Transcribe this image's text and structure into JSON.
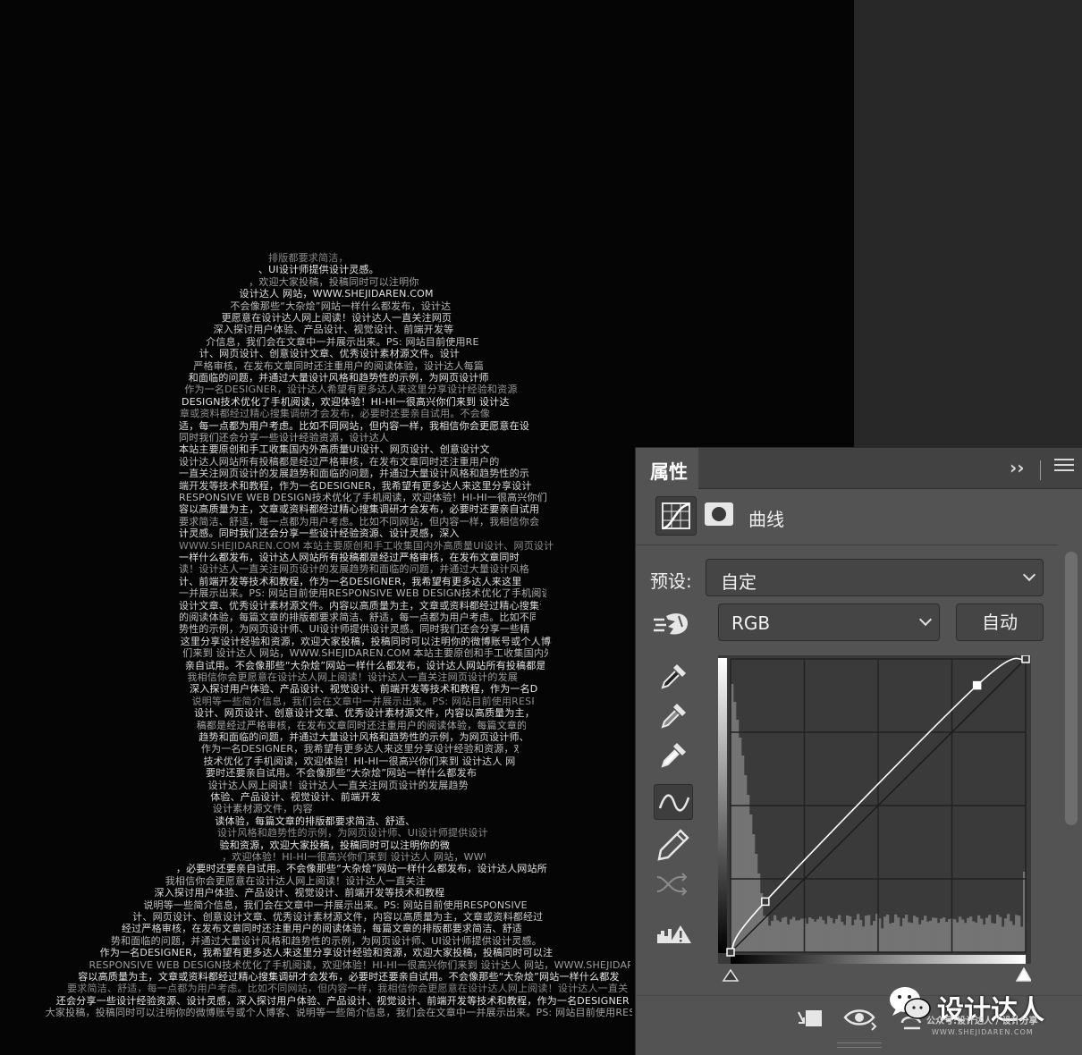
{
  "canvas": {
    "text_lines": [
      "排版都要求简洁，",
      "、UI设计师提供设计灵感。",
      "，欢迎大家投稿，投稿同时可以注明你",
      "设计达人 网站，WWW.SHEJIDAREN.COM",
      "不会像那些“大杂烩”网站一样什么都发布，设计达",
      "更愿意在设计达人网上阅读！设计达人一直关注网页",
      "深入探讨用户体验、产品设计、视觉设计、前端开发等",
      "介信息，我们会在文章中一并展示出来。PS: 网站目前使用RE",
      "计、网页设计、创意设计文章、优秀设计素材源文件。设计",
      "严格审核，在发布文章同时还注重用户的阅读体验，设计达人每篇",
      "和面临的问题，并通过大量设计风格和趋势性的示例，为网页设计师",
      "作为一名DESIGNER，设计达人希望有更多达人来这里分享设计经验和资源",
      "DESIGN技术优化了手机阅读，欢迎体验！HI-HI一很高兴你们来到 设计达",
      "章或资料都经过精心搜集调研才会发布，必要时还要亲自试用。不会像",
      "适，每一点都为用户考虑。比如不同网站，但内容一样，我相信你会更愿意在设",
      "同时我们还会分享一些设计经验资源，设计达人",
      "本站主要原创和手工收集国内外高质量UI设计、网页设计、创意设计文",
      "设计达人网站所有投稿都是经过严格审核，在发布文章同时还注重用户的",
      "一直关注网页设计的发展趋势和面临的问题，并通过大量设计风格和趋势性的示",
      "端开发等技术和教程，作为一名DESIGNER，我希望有更多达人来这里分享设计",
      "RESPONSIVE WEB DESIGN技术优化了手机阅读，欢迎体验！HI-HI一很高兴你们",
      "容以高质量为主，文章或资料都经过精心搜集调研才会发布，必要时还要亲自试用",
      "要求简洁、舒适，每一点都为用户考虑。比如不同网站，但内容一样，我相信你会",
      "计灵感。同时我们还会分享一些设计经验资源、设计灵感，深入",
      "WWW.SHEJIDAREN.COM 本站主要原创和手工收集国内外高质量UI设计、网页设计",
      "一样什么都发布，设计达人网站所有投稿都是经过严格审核，在发布文章同时",
      "读！设计达人一直关注网页设计的发展趋势和面临的问题，并通过大量设计风格",
      "计、前端开发等技术和教程，作为一名DESIGNER，我希望有更多达人来这里",
      "一并展示出来。PS: 网站目前使用RESPONSIVE WEB DESIGN技术优化了手机阅读，欢迎体验！",
      "设计文章、优秀设计素材源文件。内容以高质量为主，文章或资料都经过精心搜集调研才会发布，",
      "的阅读体验，每篇文章的排版都要求简洁、舒适，每一点都为用户考虑。比如不同网站，",
      "势性的示例，为网页设计师、UI设计师提供设计灵感。同时我们还会分享一些精品",
      "这里分享设计经验和资源，欢迎大家投稿，投稿同时可以注明你的微博账号或个人博客、说明等一些",
      "们来到 设计达人 网站，WWW.SHEJIDAREN.COM 本站主要原创和手工收集国内外",
      "亲自试用。不会像那些“大杂烩”网站一样什么都发布，设计达人网站所有投稿都是经过",
      "我相信你会更愿意在设计达人网上阅读！设计达人一直关注网页设计的发展",
      "深入探讨用户体验、产品设计、视觉设计、前端开发等技术和教程，作为一名DES",
      "说明等一些简介信息，我们会在文章中一并展示出来。PS: 网站目前使用RESPONSIVE WEB DESIGN技术",
      "设计、网页设计、创意设计文章、优秀设计素材源文件，内容以高质量为主，文章或资",
      "稿都是经过严格审核，在发布文章同时还注重用户的阅读体验，每篇文章的排版都要求简洁、舒适，每一",
      "趋势和面临的问题，并通过大量设计风格和趋势性的示例，为网页设计师、UI设计师提供设计灵感",
      "作为一名DESIGNER，我希望有更多达人来这里分享设计经验和资源，欢迎大家投稿，投稿同时可以注明",
      "技术优化了手机阅读，欢迎体验！HI-HI一很高兴你们来到 设计达人 网站，WWW.SHEJIDA",
      "要时还要亲自试用。不会像那些“大杂烩”网站一样什么都发布",
      "设计达人网上阅读！设计达人一直关注网页设计的发展趋势",
      "体验、产品设计、视觉设计、前端开发",
      "设计素材源文件，内容",
      "读体验，每篇文章的排版都要求简洁、舒适、",
      "设计风格和趋势性的示例，为网页设计师、UI设计师提供设计",
      "验和资源，欢迎大家投稿，投稿同时可以注明你的微",
      "，欢迎体验！HI-HI一很高兴你们来到 设计达人 网站，WWW.SHEJIDAREN.COM 本站主要",
      "，必要时还要亲自试用。不会像那些“大杂烩”网站一样什么都发布，设计达人网站所",
      "我相信你会更愿意在设计达人网上阅读！设计达人一直关注",
      "深入探讨用户体验、产品设计、视觉设计、前端开发等技术和教程",
      "说明等一些简介信息，我们会在文章中一并展示出来。PS: 网站目前使用RESPONSIVE",
      "计、网页设计、创意设计文章、优秀设计素材源文件，内容以高质量为主，文章或资料都经过",
      "经过严格审核，在发布文章同时还注重用户的阅读体验，每篇文章的排版都要求简洁、舒适",
      "势和面临的问题，并通过大量设计风格和趋势性的示例，为网页设计师、UI设计师提供设计灵感。",
      "作为一名DESIGNER，我希望有更多达人来这里分享设计经验和资源，欢迎大家投稿，投稿同时可以注",
      "RESPONSIVE WEB DESIGN技术优化了手机阅读，欢迎体验！HI-HI一很高兴你们来到 设计达人 网站，WWW.SHEJIDAREN.CO",
      "容以高质量为主，文章或资料都经过精心搜集调研才会发布，必要时还要亲自试用。不会像那些“大杂烩”网站一样什么都发",
      "要求简洁、舒适，每一点都为用户考虑。比如不同网站，但内容一样，我相信你会更愿意在设计达人网上阅读！设计达人一直关",
      "还会分享一些设计经验资源、设计灵感，深入探讨用户体验、产品设计、视觉设计、前端开发等技术和教程，作为一名DESIGNER",
      "大家投稿，投稿同时可以注明你的微博账号或个人博客、说明等一些简介信息，我们会在文章中一并展示出来。PS: 网站目前使用RESP"
    ]
  },
  "panel": {
    "title": "属性",
    "collapse_glyph": "››",
    "adjustment_name": "曲线",
    "preset_label": "预设:",
    "preset_value": "自定",
    "channel_value": "RGB",
    "auto_label": "自动",
    "tools": [
      "sample-black-eyedropper",
      "sample-gray-eyedropper",
      "sample-white-eyedropper",
      "edit-points-curve",
      "draw-pencil",
      "smooth-curve",
      "clipping-warning"
    ],
    "curve_points": [
      {
        "input": 0,
        "output": 0
      },
      {
        "input": 30,
        "output": 44
      },
      {
        "input": 213,
        "output": 232
      },
      {
        "input": 255,
        "output": 255
      }
    ]
  },
  "watermark": {
    "title": "设计达人",
    "subtitle": "公众号:设计达人 / 设计分享",
    "url": "WWW.SHEJIDAREN.COM"
  }
}
